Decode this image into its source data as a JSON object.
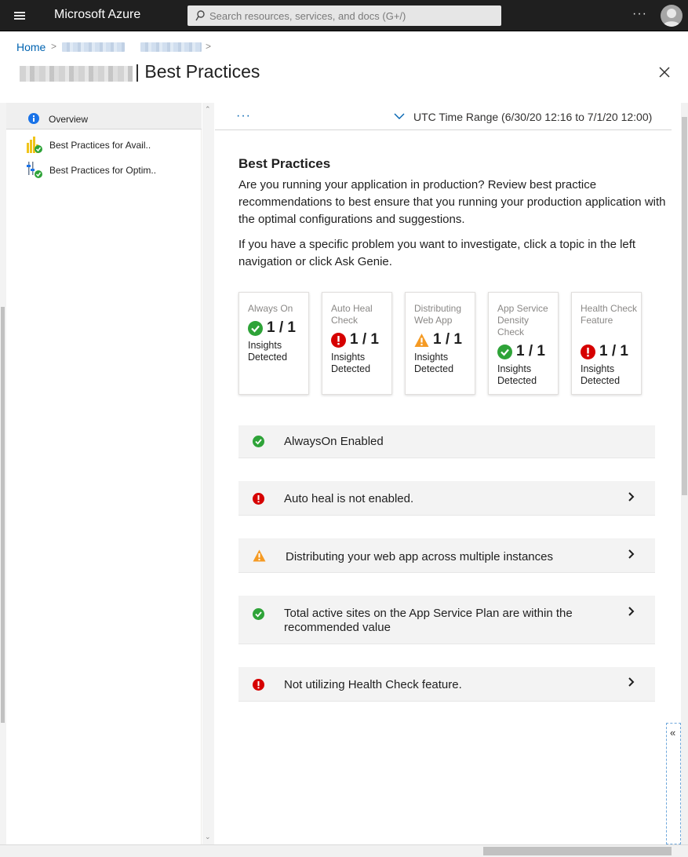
{
  "topbar": {
    "brand": "Microsoft Azure",
    "search_placeholder": "Search resources, services, and docs (G+/)",
    "more_label": "···"
  },
  "breadcrumb": {
    "home": "Home",
    "sep": ">"
  },
  "blade": {
    "title": "| Best Practices"
  },
  "leftnav": {
    "items": [
      {
        "label": "Overview",
        "icon": "info-icon",
        "active": true
      },
      {
        "label": "Best Practices for Avail..",
        "icon": "availability-chart-icon",
        "active": false
      },
      {
        "label": "Best Practices for Optim..",
        "icon": "optimization-sliders-icon",
        "active": false
      }
    ]
  },
  "commandbar": {
    "more_label": "···",
    "time_range": "UTC Time Range (6/30/20 12:16 to 7/1/20 12:00)"
  },
  "main": {
    "heading": "Best Practices",
    "intro": "Are you running your application in production? Review best practice recommendations to best ensure that you running your production application with the optimal configurations and suggestions.",
    "help": "If you have a specific problem you want to investigate, click a topic in the left navigation or click Ask Genie.",
    "cards": [
      {
        "title": "Always On",
        "status": "success",
        "value": "1 / 1",
        "label": "Insights Detected"
      },
      {
        "title": "Auto Heal Check",
        "status": "critical",
        "value": "1 / 1",
        "label": "Insights Detected"
      },
      {
        "title": "Distributing Web App",
        "status": "warning",
        "value": "1 / 1",
        "label": "Insights Detected"
      },
      {
        "title": "App Service Density Check",
        "status": "success",
        "value": "1 / 1",
        "label": "Insights Detected"
      },
      {
        "title": "Health Check Feature",
        "status": "critical",
        "value": "1 / 1",
        "label": "Insights Detected"
      }
    ],
    "insights": [
      {
        "text": "AlwaysOn Enabled",
        "status": "success",
        "expandable": false
      },
      {
        "text": "Auto heal is not enabled.",
        "status": "critical",
        "expandable": true
      },
      {
        "text": "Distributing your web app across multiple instances",
        "status": "warning",
        "expandable": true
      },
      {
        "text": "Total active sites on the App Service Plan are within the recommended value",
        "status": "success",
        "expandable": true
      },
      {
        "text": "Not utilizing Health Check feature.",
        "status": "critical",
        "expandable": true
      }
    ]
  },
  "collapse_label": "«",
  "colors": {
    "topbar": "#1f1f1f",
    "link": "#0063b1",
    "success": "#2ea338",
    "critical": "#d60000",
    "warning": "#f59a23",
    "info": "#1a73e8"
  }
}
